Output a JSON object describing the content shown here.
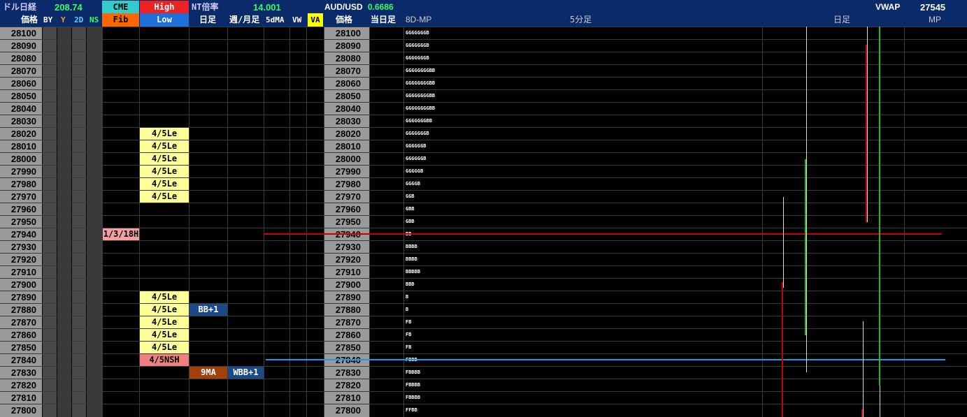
{
  "header": {
    "row1": {
      "nikkei_dollar_label": "ドル日経",
      "nikkei_dollar_value": "208.74",
      "cme": "CME",
      "high": "High",
      "nt_label": "NT倍率",
      "nt_value": "14.001",
      "audusd_label": "AUD/USD",
      "audusd_value": "0.6686",
      "vwap_label": "VWAP",
      "vwap_value": "27545"
    },
    "row2": {
      "price": "価格",
      "by": "BY",
      "y": "Y",
      "two_d": "2D",
      "ns": "NS",
      "fib": "Fib",
      "low": "Low",
      "daily": "日足",
      "weekly_monthly": "週/月足",
      "ma5d": "5dMA",
      "vw": "VW",
      "va": "VA",
      "price2": "価格",
      "today": "当日足",
      "mp8d": "8D-MP",
      "min5": "5分足",
      "daily2": "日足",
      "mp": "MP"
    }
  },
  "prices": [
    "28100",
    "28090",
    "28080",
    "28070",
    "28060",
    "28050",
    "28040",
    "28030",
    "28020",
    "28010",
    "28000",
    "27990",
    "27980",
    "27970",
    "27960",
    "27950",
    "27940",
    "27930",
    "27920",
    "27910",
    "27900",
    "27890",
    "27880",
    "27870",
    "27860",
    "27850",
    "27840",
    "27830",
    "27820",
    "27810",
    "27800"
  ],
  "low_labels": [
    {
      "row": 8,
      "text": "4/5Le",
      "kind": "le"
    },
    {
      "row": 9,
      "text": "4/5Le",
      "kind": "le"
    },
    {
      "row": 10,
      "text": "4/5Le",
      "kind": "le"
    },
    {
      "row": 11,
      "text": "4/5Le",
      "kind": "le"
    },
    {
      "row": 12,
      "text": "4/5Le",
      "kind": "le"
    },
    {
      "row": 13,
      "text": "4/5Le",
      "kind": "le"
    },
    {
      "row": 21,
      "text": "4/5Le",
      "kind": "le"
    },
    {
      "row": 22,
      "text": "4/5Le",
      "kind": "le"
    },
    {
      "row": 23,
      "text": "4/5Le",
      "kind": "le"
    },
    {
      "row": 24,
      "text": "4/5Le",
      "kind": "le"
    },
    {
      "row": 25,
      "text": "4/5Le",
      "kind": "le"
    },
    {
      "row": 26,
      "text": "4/5NSH",
      "kind": "nsh"
    }
  ],
  "fib_labels": [
    {
      "row": 16,
      "text": "1/3/18H"
    }
  ],
  "daily_labels": [
    {
      "row": 22,
      "text": "BB+1",
      "kind": "blue"
    },
    {
      "row": 27,
      "text": "9MA",
      "kind": "brown"
    }
  ],
  "weekly_labels": [
    {
      "row": 27,
      "text": "WBB+1",
      "kind": "blue"
    }
  ],
  "market_profile": [
    "GGGGGGGB",
    "GGGGGGGB",
    "GGGGGGGB",
    "GGGGGGGGBB",
    "GGGGGGGGBB",
    "GGGGGGGGBB",
    "GGGGGGGGBB",
    "GGGGGGGBB",
    "GGGGGGGB",
    "GGGGGGB",
    "GGGGGGB",
    "GGGGGB",
    "GGGGB",
    "GGB",
    "GBB",
    "GBB",
    "BB",
    "BBBB",
    "BBBB",
    "BBBBB",
    "BBB",
    "B",
    "B",
    "FB",
    "FB",
    "FB",
    "FBBB",
    "FBBBB",
    "FBBBB",
    "FBBBB",
    "FFBB"
  ],
  "colors": {
    "header_bg": "#0a2a6a",
    "price_bg": "#9a9a9a",
    "cme_bg": "#33cccc",
    "high_bg": "#ee2222",
    "fib_bg": "#ff6600",
    "low_bg": "#1e6fd9",
    "va_bg": "#ffff00",
    "le_bg": "#ffff99",
    "nsh_bg": "#f08080",
    "fib_label_bg": "#f4a0a0",
    "blue_label_bg": "#1a4a8a",
    "brown_label_bg": "#a0400a",
    "green_value": "#33ff66",
    "red_line": "#cc0000",
    "blue_line": "#2299dd",
    "green_candle": "#22bb22",
    "red_candle": "#cc0000"
  }
}
